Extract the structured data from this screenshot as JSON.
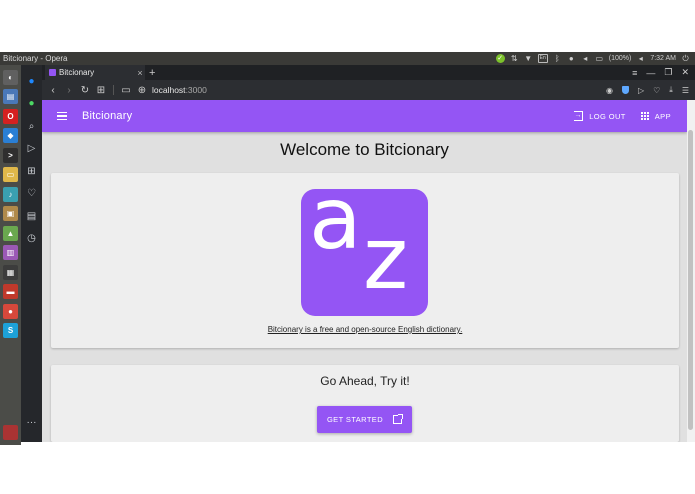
{
  "system": {
    "window_title": "Bitcionary - Opera",
    "battery": "(100%)",
    "time": "7:32 AM"
  },
  "launcher_icons": [
    {
      "name": "dash-icon",
      "color": "#606060",
      "glyph": "◐"
    },
    {
      "name": "files-icon",
      "color": "#4a78b8",
      "glyph": "▤"
    },
    {
      "name": "opera-icon",
      "color": "#d42121",
      "glyph": "O"
    },
    {
      "name": "vscode-icon",
      "color": "#2a7fd4",
      "glyph": "◆"
    },
    {
      "name": "terminal-icon",
      "color": "#2f2f2f",
      "glyph": ">"
    },
    {
      "name": "folder-icon",
      "color": "#e0b84a",
      "glyph": "▭"
    },
    {
      "name": "sound-icon",
      "color": "#3aa0b0",
      "glyph": "♪"
    },
    {
      "name": "archive-icon",
      "color": "#b08a4a",
      "glyph": "▣"
    },
    {
      "name": "android-icon",
      "color": "#6aa84f",
      "glyph": "▲"
    },
    {
      "name": "app-icon",
      "color": "#9b59b6",
      "glyph": "▥"
    },
    {
      "name": "monitor-icon",
      "color": "#3c3c3c",
      "glyph": "▦"
    },
    {
      "name": "presentation-icon",
      "color": "#c0392b",
      "glyph": "▬"
    },
    {
      "name": "chrome-icon",
      "color": "#d6483b",
      "glyph": "●"
    },
    {
      "name": "skype-icon",
      "color": "#1da1d8",
      "glyph": "S"
    }
  ],
  "browser": {
    "tab_title": "Bitcionary",
    "new_tab": "+",
    "url_host": "localhost",
    "url_port": ":3000"
  },
  "app": {
    "title": "Bitcionary",
    "logout_label": "LOG OUT",
    "app_label": "APP",
    "welcome": "Welcome to Bitcionary",
    "tagline": "Bitcionary is a free and open-source English dictionary.",
    "logo_a": "a",
    "logo_z": "z",
    "cta_title": "Go Ahead, Try it!",
    "cta_button": "GET STARTED"
  },
  "colors": {
    "brand_purple": "#9455f4",
    "page_background": "#e0e0e0",
    "card_background": "#eeeeee"
  }
}
